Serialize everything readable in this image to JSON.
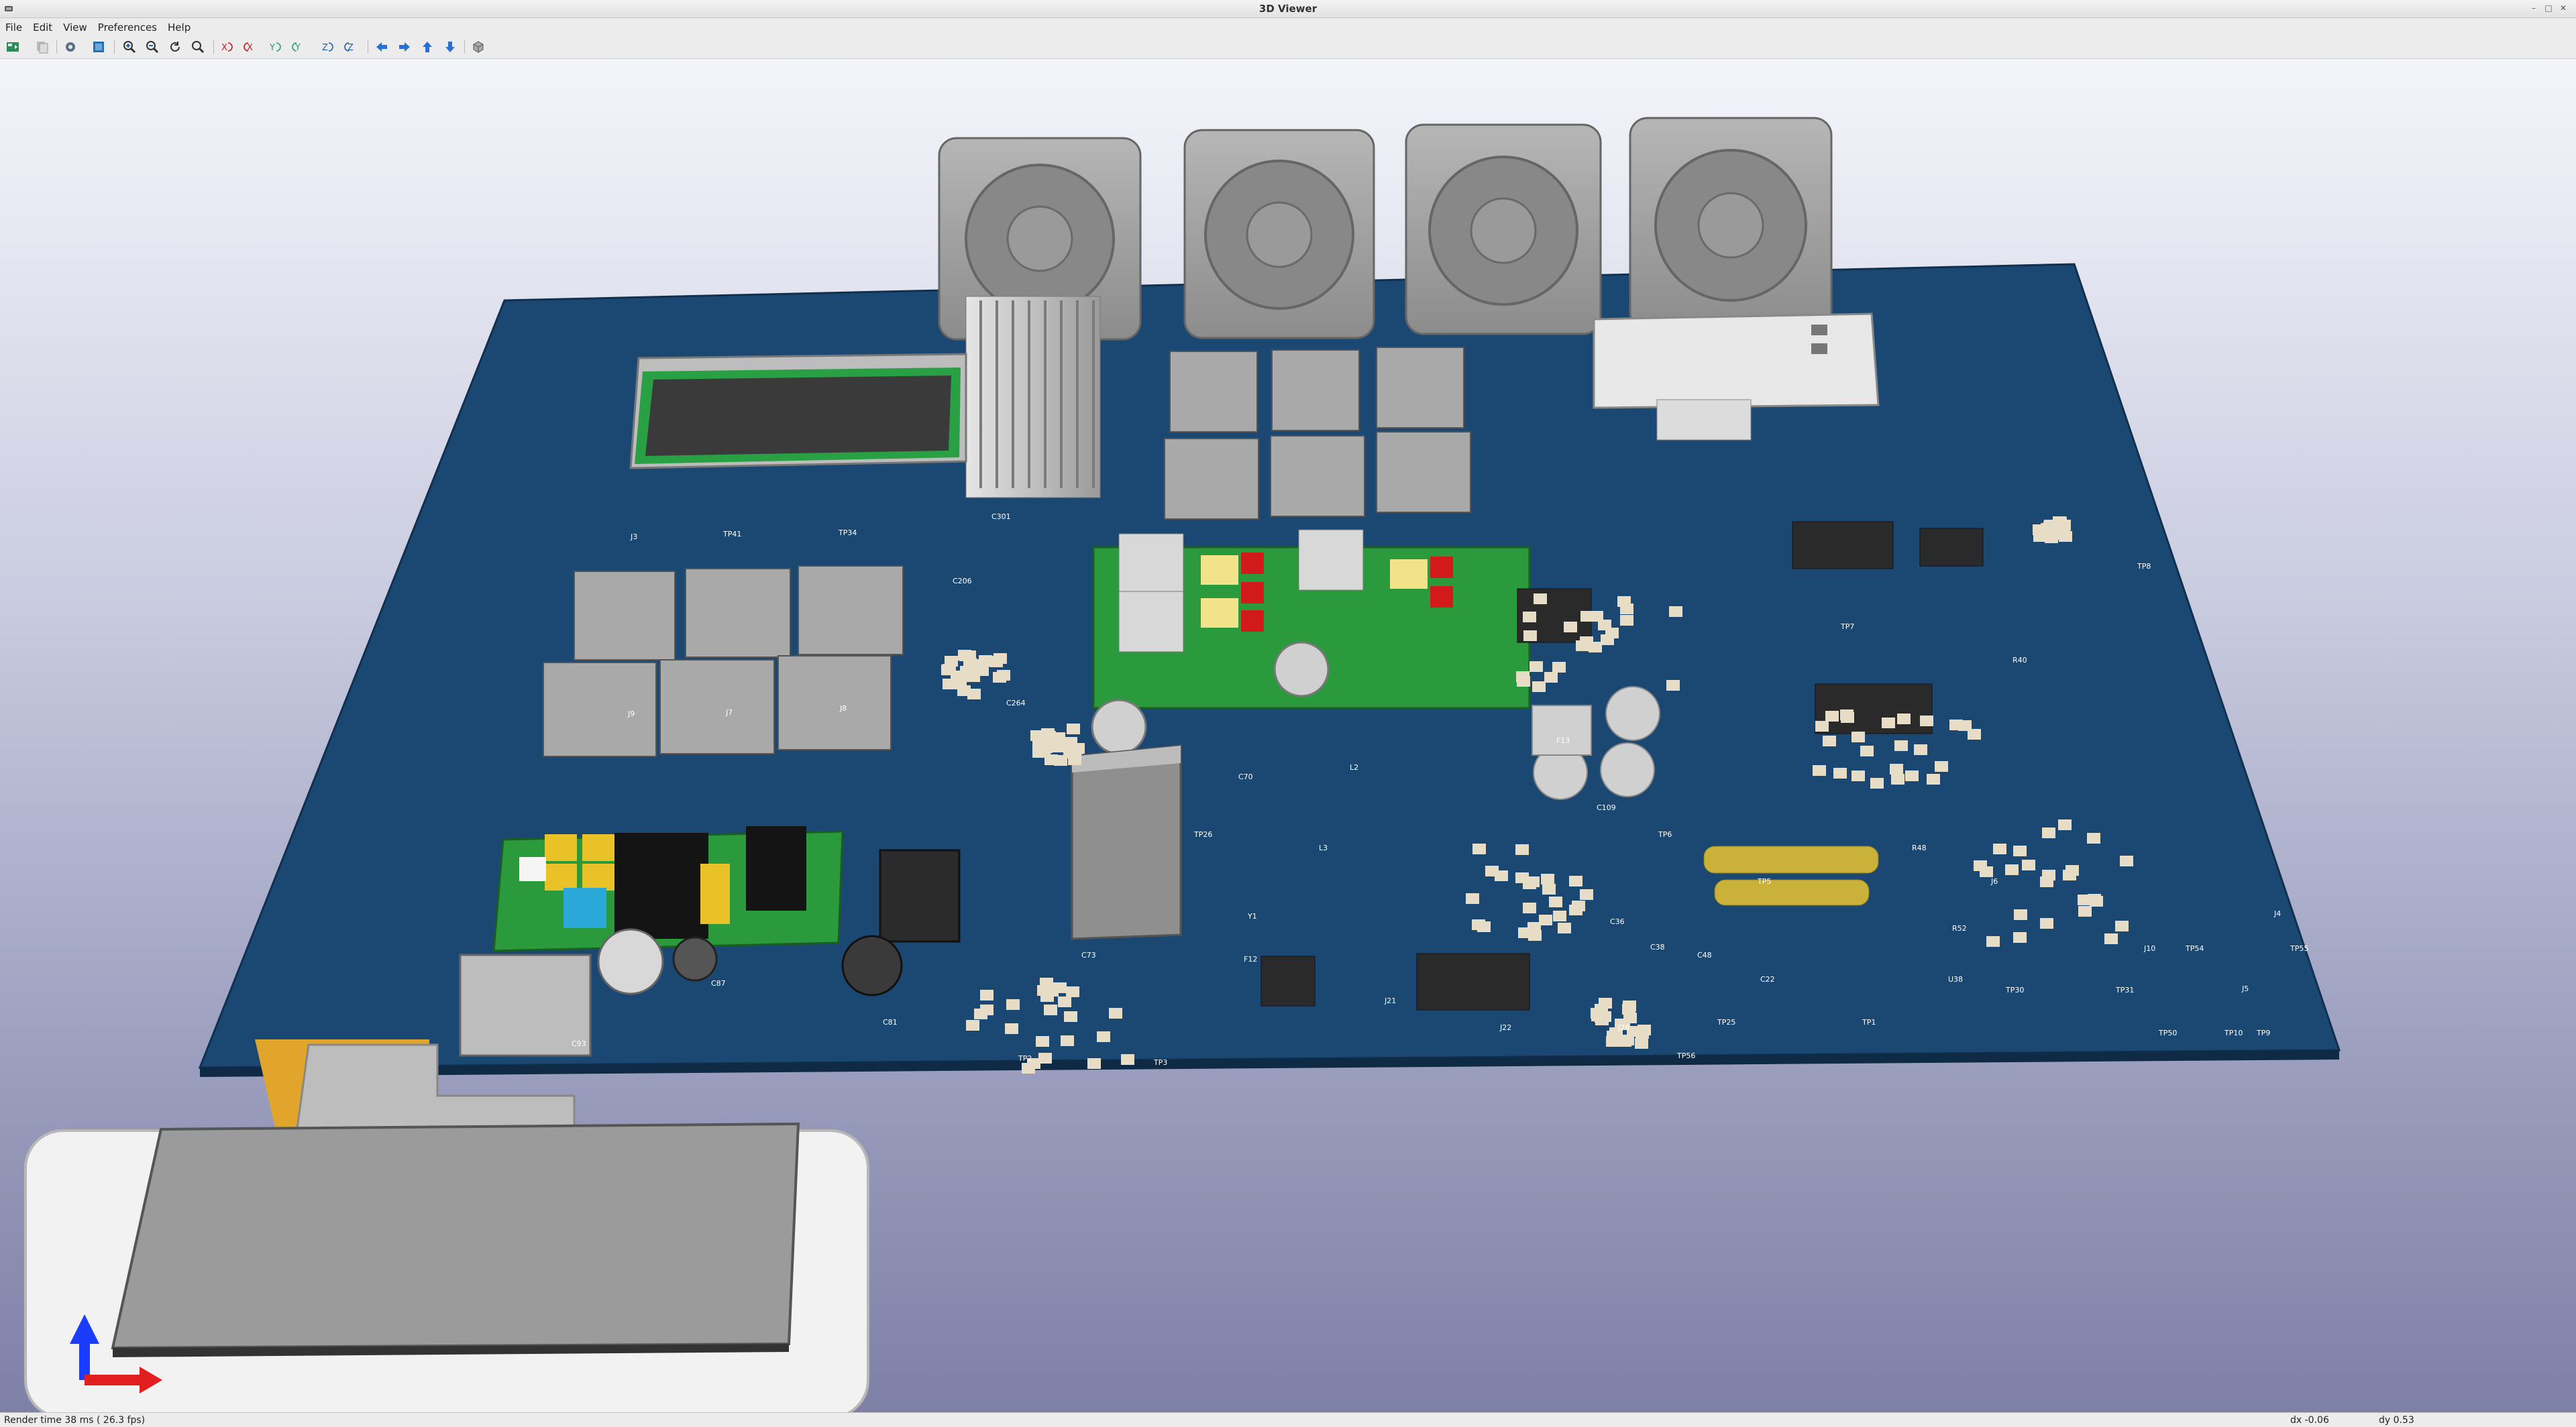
{
  "window": {
    "title": "3D Viewer"
  },
  "menu": [
    "File",
    "Edit",
    "View",
    "Preferences",
    "Help"
  ],
  "toolbar": {
    "icons": [
      "reload-board-icon",
      "copy-image-icon",
      "render-options-icon",
      "raytrace-icon",
      "zoom-in-icon",
      "zoom-out-icon",
      "redraw-icon",
      "zoom-fit-icon",
      "rotate-x-cw-icon",
      "rotate-x-ccw-icon",
      "rotate-y-cw-icon",
      "rotate-y-ccw-icon",
      "rotate-z-cw-icon",
      "rotate-z-ccw-icon",
      "pan-left-icon",
      "pan-right-icon",
      "pan-up-icon",
      "pan-down-icon",
      "ortho-view-icon"
    ]
  },
  "status": {
    "render": "Render time 38 ms ( 26.3 fps)",
    "dx": "dx -0.06",
    "dy": "dy 0.53"
  },
  "colors": {
    "board": "#1b4872",
    "pad": "#e7dcc6",
    "component_gray": "#9c9c9c",
    "pcb_green": "#2a9a3d"
  },
  "labels": [
    "C301",
    "J3",
    "TP41",
    "TP34",
    "J9",
    "J7",
    "J8",
    "J6",
    "J10",
    "J4",
    "J5",
    "TP31",
    "TP30",
    "F12",
    "J21",
    "J22",
    "J26",
    "C22",
    "C70",
    "C73",
    "C81",
    "C87",
    "C93",
    "U38",
    "TP1",
    "TP2",
    "TP3",
    "TP5",
    "TP6",
    "TP7",
    "TP8",
    "TP9",
    "TP10",
    "TP50",
    "TP54",
    "TP55",
    "TP56",
    "TP25",
    "TP26",
    "L2",
    "L3",
    "Y1",
    "F13",
    "C109",
    "C206",
    "C264",
    "R40",
    "R48",
    "R52",
    "C36",
    "C38",
    "C48"
  ]
}
